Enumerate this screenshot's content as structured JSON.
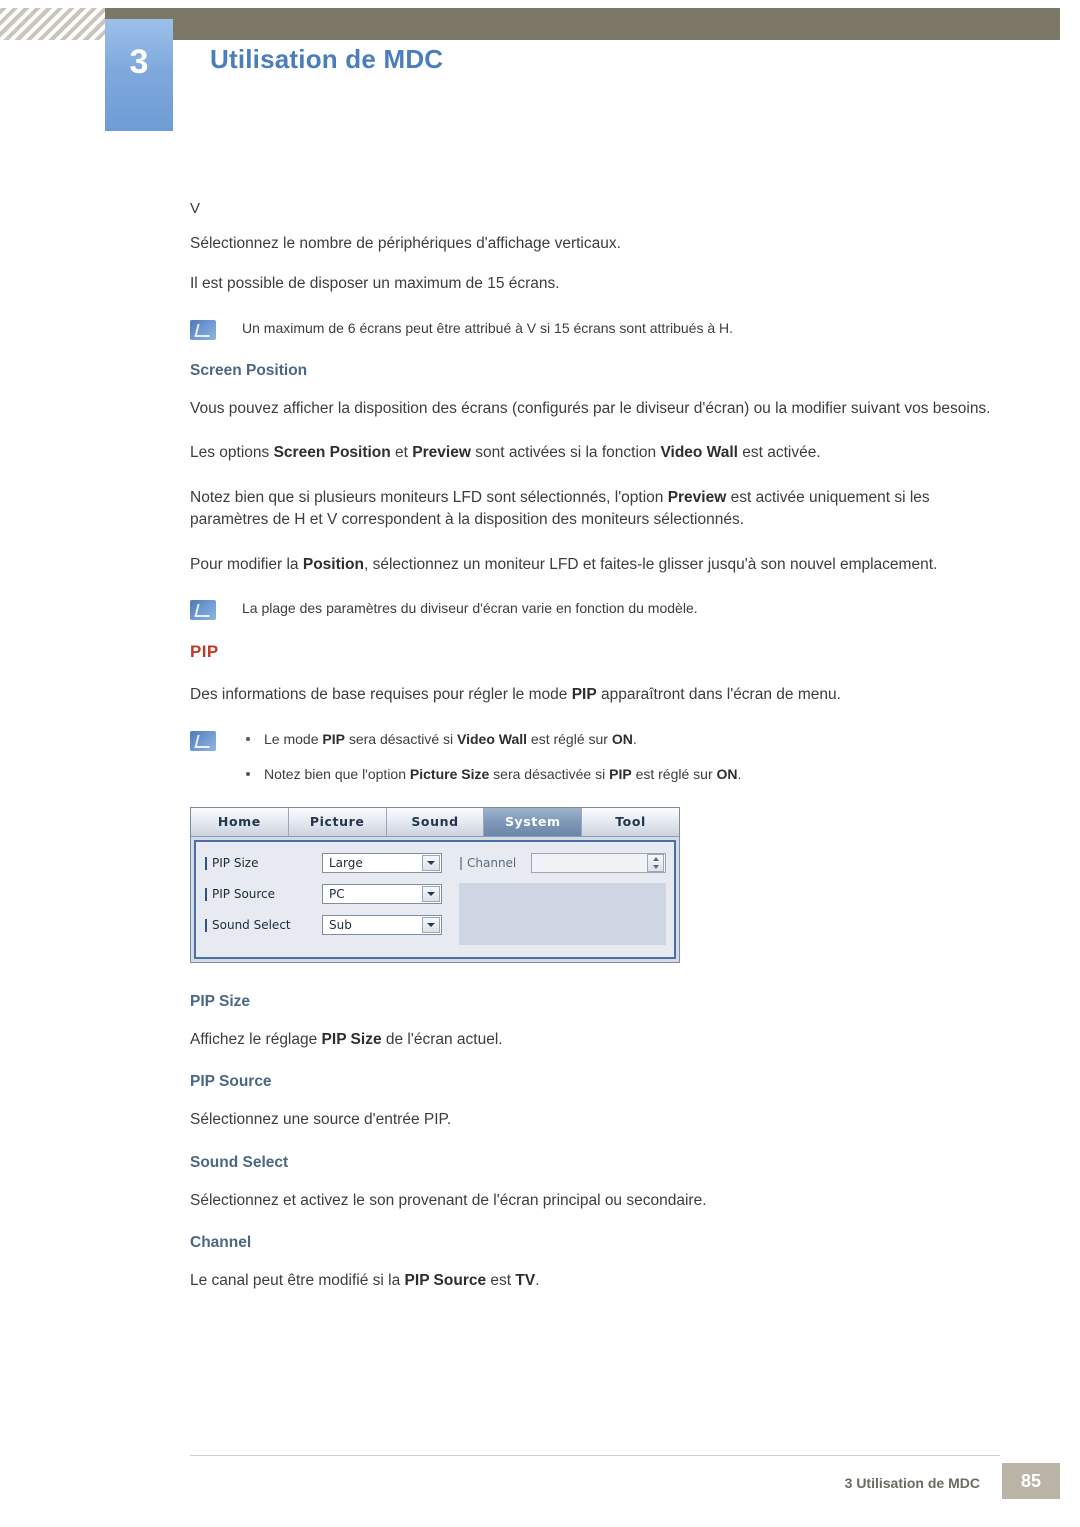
{
  "header": {
    "chapter_number": "3",
    "chapter_title": "Utilisation de MDC"
  },
  "body": {
    "v_label": "V",
    "v_desc1": "Sélectionnez le nombre de périphériques d'affichage verticaux.",
    "v_desc2": "Il est possible de disposer un maximum de 15 écrans.",
    "note1": "Un maximum de 6 écrans peut être attribué à V si 15 écrans sont attribués à H.",
    "screen_position_head": "Screen Position",
    "sp_p1": "Vous pouvez afficher la disposition des écrans (configurés par le diviseur d'écran) ou la modifier suivant vos besoins.",
    "sp_p2_a": "Les options ",
    "sp_p2_b": "Screen Position",
    "sp_p2_c": " et ",
    "sp_p2_d": "Preview",
    "sp_p2_e": " sont activées si la fonction ",
    "sp_p2_f": "Video Wall",
    "sp_p2_g": " est activée.",
    "sp_p3_a": "Notez bien que si plusieurs moniteurs LFD sont sélectionnés, l'option ",
    "sp_p3_b": "Preview",
    "sp_p3_c": " est activée uniquement si les paramètres de H et V correspondent à la disposition des moniteurs sélectionnés.",
    "sp_p4_a": "Pour modifier la ",
    "sp_p4_b": "Position",
    "sp_p4_c": ", sélectionnez un moniteur LFD et faites-le glisser jusqu'à son nouvel emplacement.",
    "note2": "La plage des paramètres du diviseur d'écran varie en fonction du modèle.",
    "pip_head": "PIP",
    "pip_p1_a": "Des informations de base requises pour régler le mode ",
    "pip_p1_b": "PIP",
    "pip_p1_c": " apparaîtront dans l'écran de menu.",
    "pip_note_1_a": "Le mode ",
    "pip_note_1_b": "PIP",
    "pip_note_1_c": " sera désactivé si ",
    "pip_note_1_d": "Video Wall",
    "pip_note_1_e": " est réglé sur ",
    "pip_note_1_f": "ON",
    "pip_note_1_g": ".",
    "pip_note_2_a": "Notez bien que l'option ",
    "pip_note_2_b": "Picture Size",
    "pip_note_2_c": " sera désactivée si ",
    "pip_note_2_d": "PIP",
    "pip_note_2_e": " est réglé sur ",
    "pip_note_2_f": "ON",
    "pip_note_2_g": ".",
    "pip_size_head": "PIP Size",
    "pip_size_p_a": "Affichez le réglage ",
    "pip_size_p_b": "PIP Size",
    "pip_size_p_c": " de l'écran actuel.",
    "pip_source_head": "PIP Source",
    "pip_source_p": "Sélectionnez une source d'entrée PIP.",
    "sound_select_head": "Sound Select",
    "sound_select_p": "Sélectionnez et activez le son provenant de l'écran principal ou secondaire.",
    "channel_head": "Channel",
    "channel_p_a": "Le canal peut être modifié si la ",
    "channel_p_b": "PIP Source",
    "channel_p_c": " est ",
    "channel_p_d": "TV",
    "channel_p_e": "."
  },
  "mdc_widget": {
    "tabs": [
      {
        "label": "Home",
        "active": false
      },
      {
        "label": "Picture",
        "active": false
      },
      {
        "label": "Sound",
        "active": false
      },
      {
        "label": "System",
        "active": true
      },
      {
        "label": "Tool",
        "active": false
      }
    ],
    "fields": [
      {
        "label": "PIP Size",
        "value": "Large"
      },
      {
        "label": "PIP Source",
        "value": "PC"
      },
      {
        "label": "Sound Select",
        "value": "Sub"
      }
    ],
    "channel_label": "Channel",
    "channel_value": ""
  },
  "footer": {
    "text": "3 Utilisation de MDC",
    "page": "85"
  }
}
